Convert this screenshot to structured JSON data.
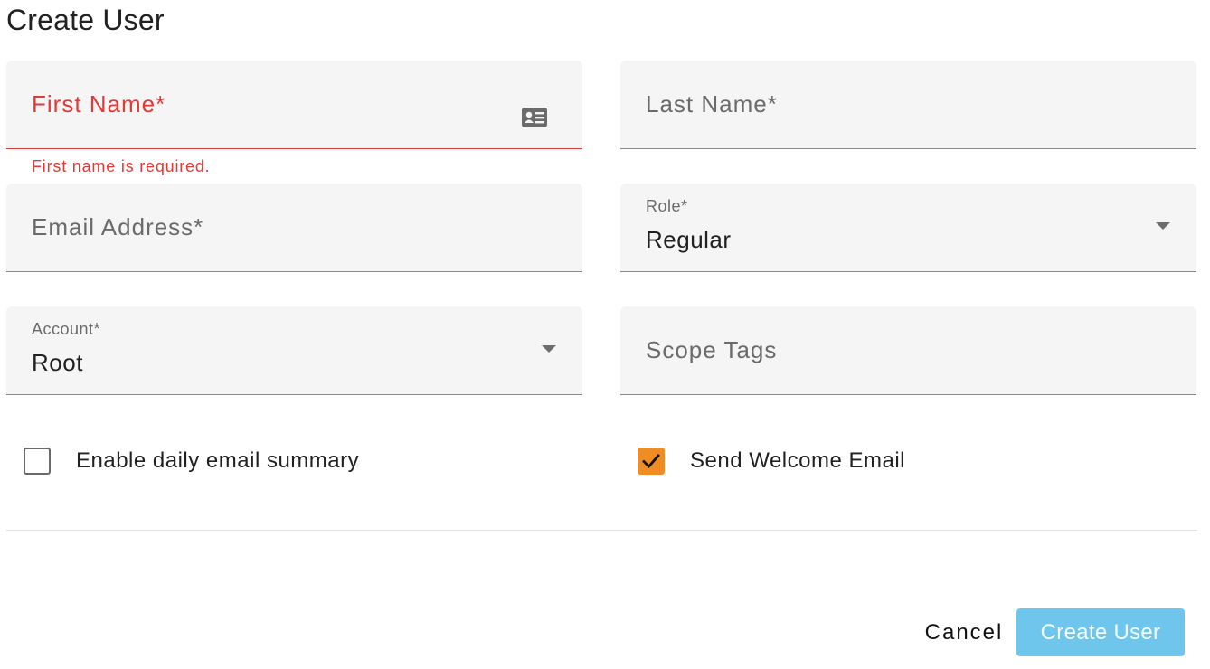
{
  "page": {
    "title": "Create User"
  },
  "form": {
    "first_name": {
      "label": "First Name*",
      "error": "First name is required.",
      "icon": "contact-card-icon"
    },
    "last_name": {
      "label": "Last Name*"
    },
    "email": {
      "label": "Email Address*"
    },
    "role": {
      "label": "Role*",
      "value": "Regular"
    },
    "account": {
      "label": "Account*",
      "value": "Root"
    },
    "scope_tags": {
      "label": "Scope Tags"
    },
    "daily_summary": {
      "label": "Enable daily email summary",
      "checked": false
    },
    "welcome_email": {
      "label": "Send Welcome Email",
      "checked": true
    }
  },
  "actions": {
    "cancel_label": "Cancel",
    "submit_label": "Create User"
  },
  "colors": {
    "error": "#e53935",
    "accent_checkbox": "#f08c24",
    "primary_button_disabled": "#6ec6ec",
    "field_background": "#f5f5f5"
  }
}
